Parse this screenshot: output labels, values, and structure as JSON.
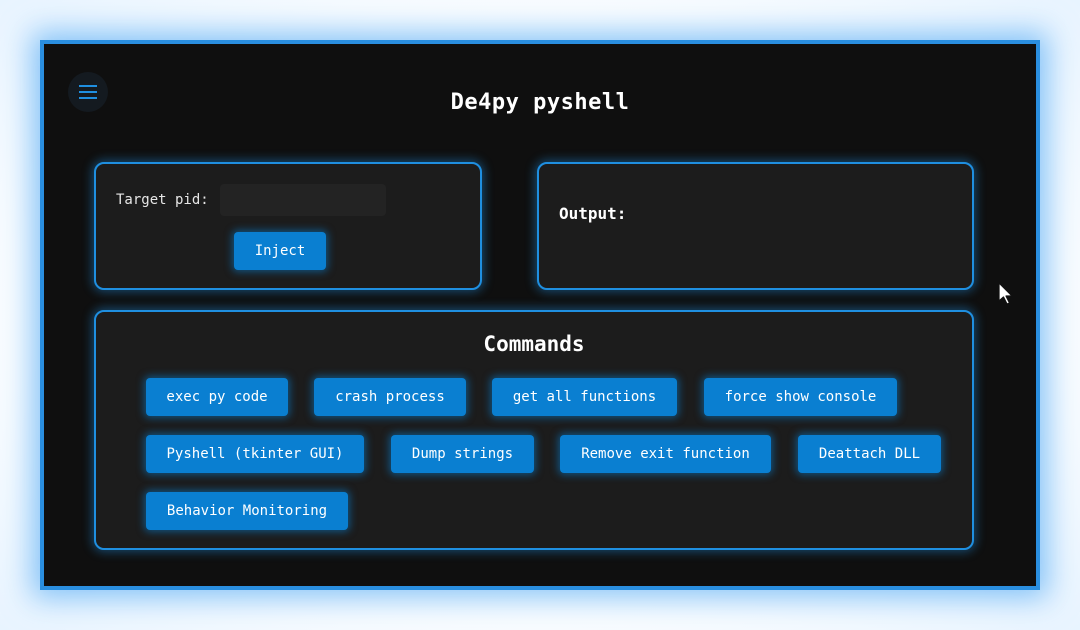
{
  "app": {
    "title": "De4py pyshell"
  },
  "menu": {
    "icon": "hamburger-menu-icon",
    "accent_color": "#1f8fe0"
  },
  "inject_panel": {
    "pid_label": "Target pid:",
    "pid_value": "",
    "pid_placeholder": "",
    "inject_label": "Inject"
  },
  "output_panel": {
    "label": "Output:"
  },
  "commands_panel": {
    "title": "Commands",
    "buttons": [
      {
        "label": "exec py code"
      },
      {
        "label": "crash process"
      },
      {
        "label": "get all functions"
      },
      {
        "label": "force show console"
      },
      {
        "label": "Pyshell (tkinter GUI)"
      },
      {
        "label": "Dump strings"
      },
      {
        "label": "Remove exit function"
      },
      {
        "label": "Deattach DLL"
      },
      {
        "label": "Behavior Monitoring"
      }
    ]
  },
  "colors": {
    "background": "#0f0f0f",
    "panel": "#1c1c1c",
    "border": "#1f8fe0",
    "button": "#0a7fd1",
    "text": "#ffffff"
  }
}
